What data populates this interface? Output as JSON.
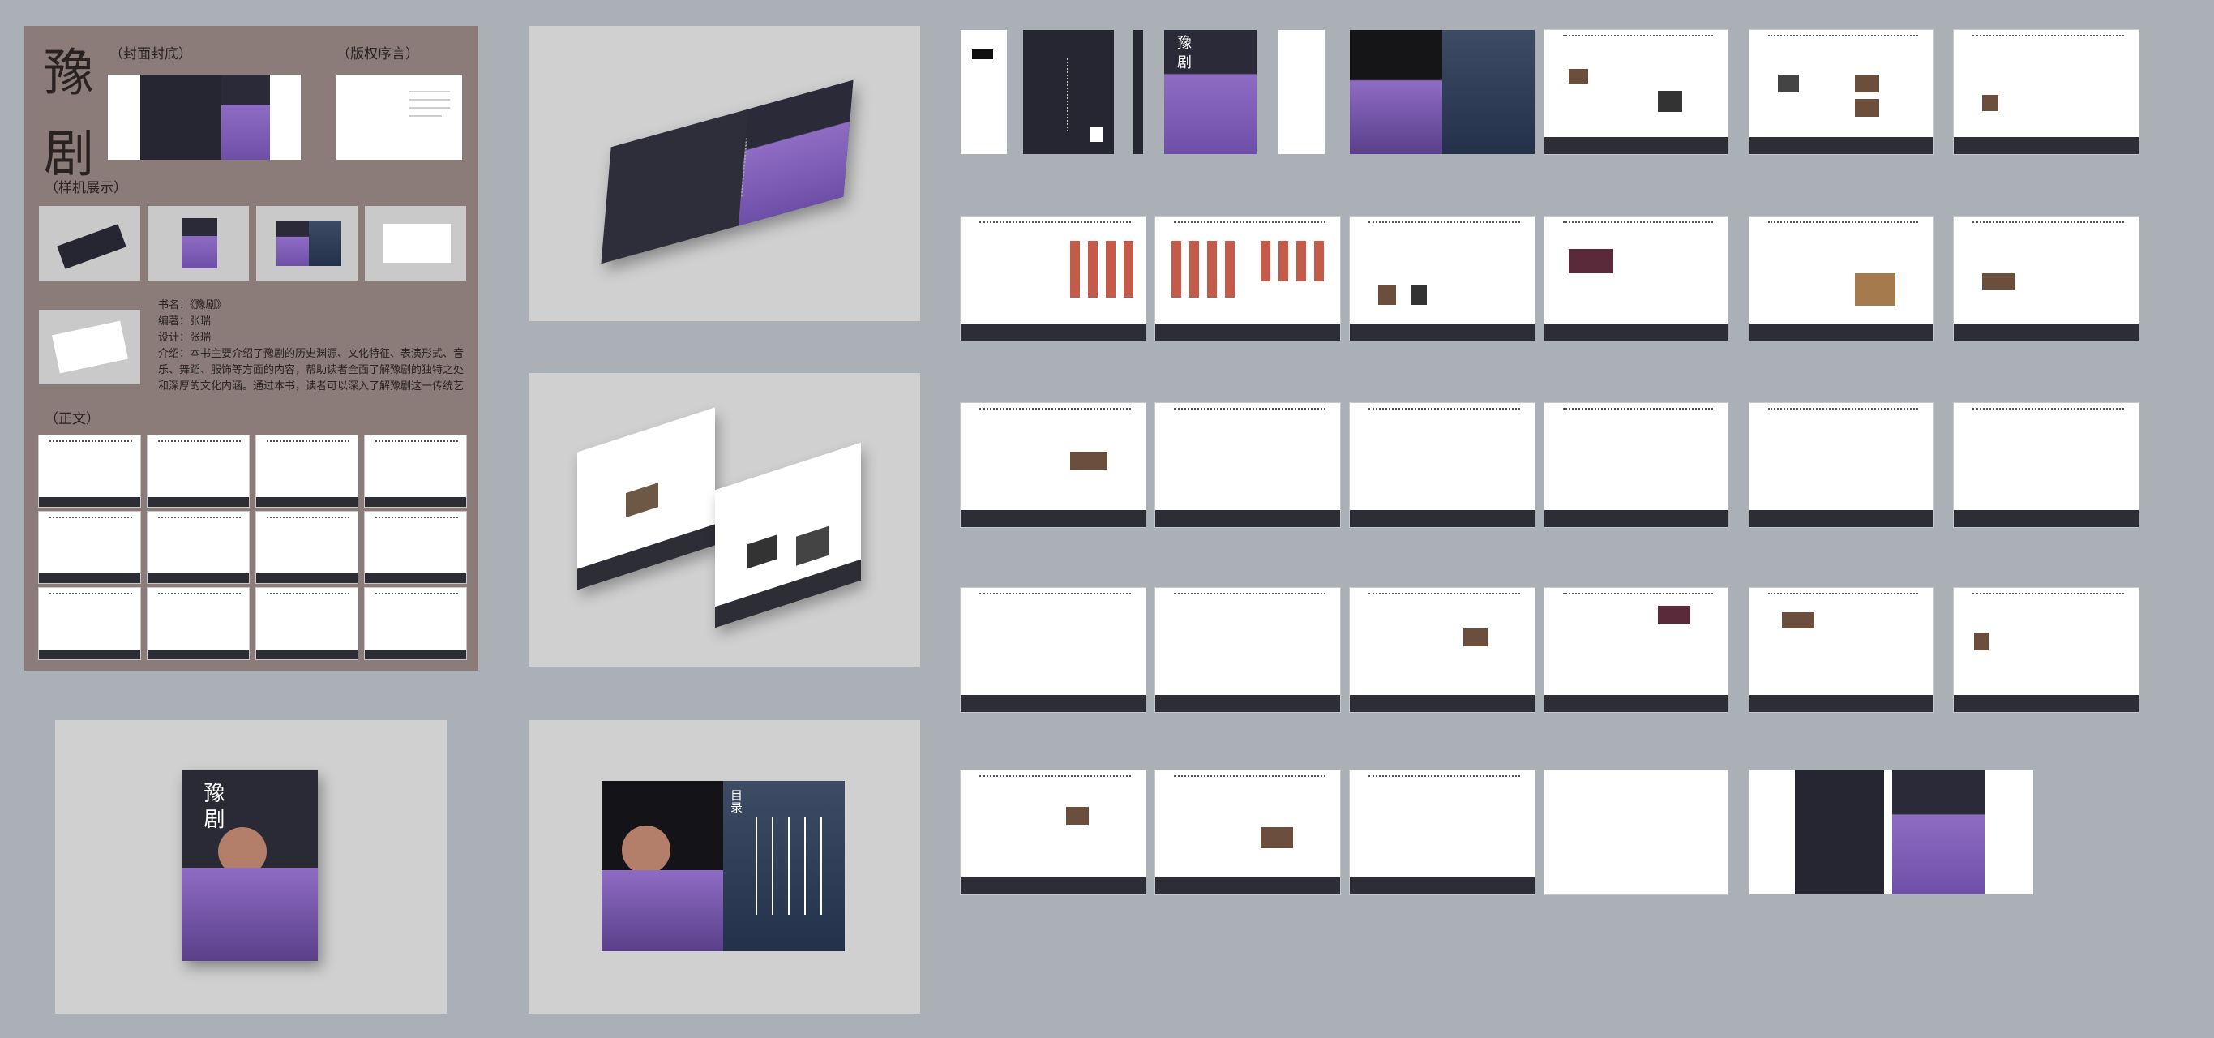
{
  "panel": {
    "title_chars": [
      "豫",
      "剧"
    ],
    "label_cover": "（封面封底）",
    "label_copyright": "（版权序言）",
    "label_mockups": "（样机展示）",
    "label_main": "（正文）",
    "info": {
      "book_name": "书名：《豫剧》",
      "author": "编著：张瑞",
      "designer": "设计：张瑞",
      "intro": "介绍：本书主要介绍了豫剧的历史渊源、文化特征、表演形式、音乐、舞蹈、服饰等方面的内容，帮助读者全面了解豫剧的独特之处和深厚的文化内涵。通过本书，读者可以深入了解豫剧这一传统艺术形式的发展历程，表演特色和文化内涵，感受其独特的魅力。"
    }
  },
  "cover": {
    "title": "豫剧"
  },
  "toc": {
    "label": "目录"
  },
  "colors": {
    "background": "#abafb6",
    "panel": "#8b7b79",
    "dark_navy": "#262633",
    "costume_purple": "#7a58b5"
  }
}
